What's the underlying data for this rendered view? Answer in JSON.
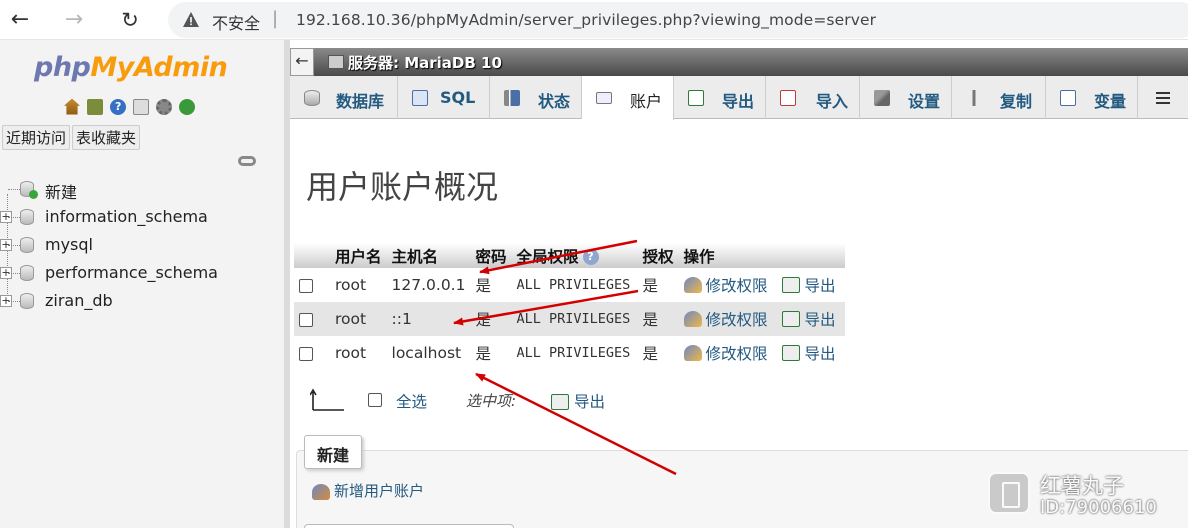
{
  "browser": {
    "security_label": "不安全",
    "separator": "|",
    "url": "192.168.10.36/phpMyAdmin/server_privileges.php?viewing_mode=server"
  },
  "sidebar": {
    "logo_php": "php",
    "logo_myadmin": "MyAdmin",
    "tabs": [
      {
        "label": "近期访问"
      },
      {
        "label": "表收藏夹"
      }
    ],
    "tree": [
      {
        "label": "新建"
      },
      {
        "label": "information_schema"
      },
      {
        "label": "mysql"
      },
      {
        "label": "performance_schema"
      },
      {
        "label": "ziran_db"
      }
    ]
  },
  "main": {
    "server_label": "服务器: MariaDB 10",
    "tabs": [
      {
        "label": "数据库",
        "icon": "database-icon"
      },
      {
        "label": "SQL",
        "icon": "sql-icon"
      },
      {
        "label": "状态",
        "icon": "status-icon"
      },
      {
        "label": "账户",
        "icon": "accounts-icon"
      },
      {
        "label": "导出",
        "icon": "export-icon"
      },
      {
        "label": "导入",
        "icon": "import-icon"
      },
      {
        "label": "设置",
        "icon": "settings-icon"
      },
      {
        "label": "复制",
        "icon": "replication-icon"
      },
      {
        "label": "变量",
        "icon": "variables-icon"
      }
    ],
    "page_title": "用户账户概况",
    "table": {
      "headers": [
        "用户名",
        "主机名",
        "密码",
        "全局权限",
        "授权",
        "操作"
      ],
      "rows": [
        {
          "user": "root",
          "host": "127.0.0.1",
          "password": "是",
          "privileges": "ALL PRIVILEGES",
          "grant": "是",
          "edit": "修改权限",
          "export": "导出"
        },
        {
          "user": "root",
          "host": "::1",
          "password": "是",
          "privileges": "ALL PRIVILEGES",
          "grant": "是",
          "edit": "修改权限",
          "export": "导出"
        },
        {
          "user": "root",
          "host": "localhost",
          "password": "是",
          "privileges": "ALL PRIVILEGES",
          "grant": "是",
          "edit": "修改权限",
          "export": "导出"
        }
      ]
    },
    "with_selected": {
      "select_all": "全选",
      "label": "选中项:",
      "export": "导出"
    },
    "new_section": {
      "legend": "新建",
      "add_user": "新增用户账户"
    }
  },
  "watermark": {
    "name": "红薯丸子",
    "id": "ID:79006610"
  },
  "colors": {
    "link": "#235a81",
    "annotation_arrow": "#d40000"
  }
}
